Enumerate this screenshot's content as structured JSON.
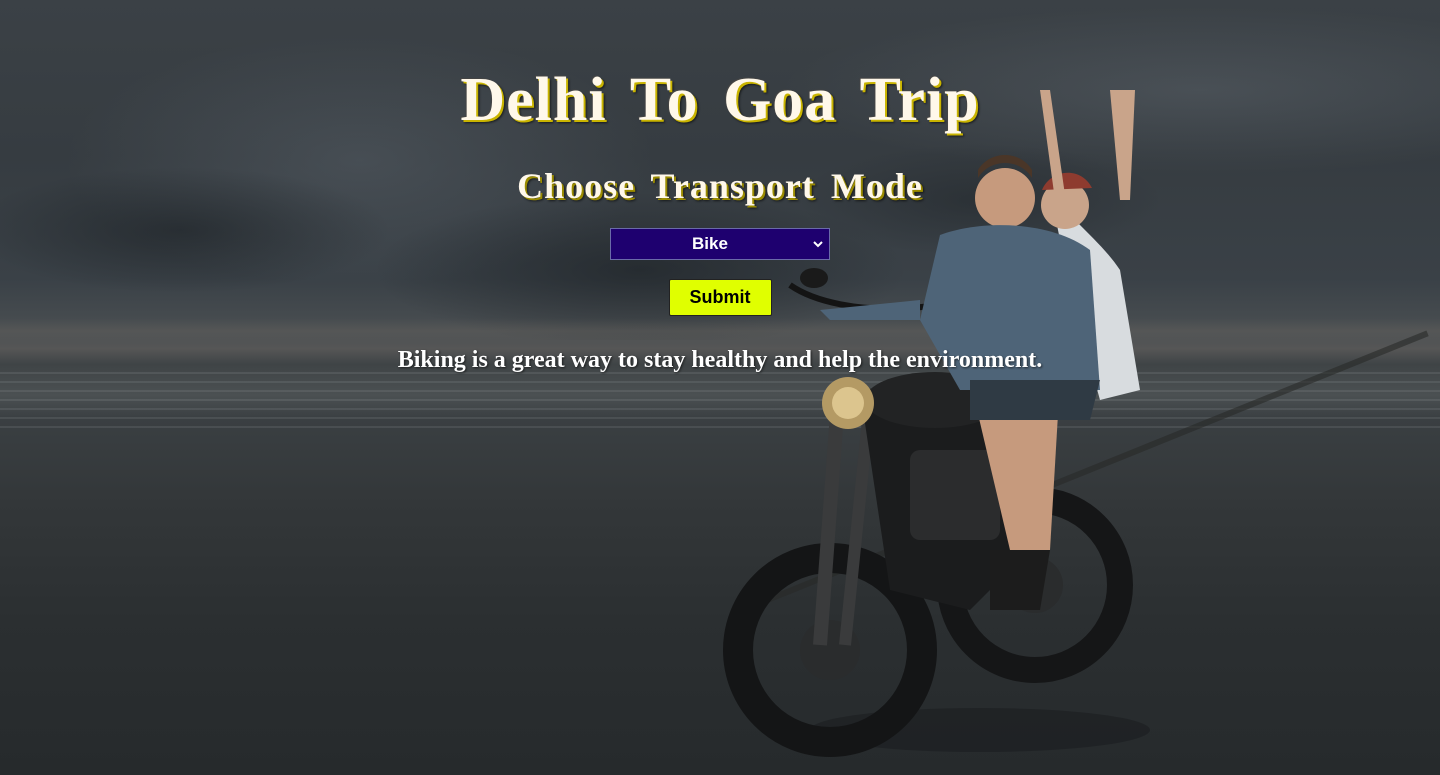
{
  "page": {
    "title": "Delhi To Goa Trip",
    "subtitle": "Choose Transport Mode"
  },
  "transport_select": {
    "selected": "Bike",
    "background_color": "#1e006f"
  },
  "submit": {
    "label": "Submit",
    "background_color": "#e0ff00"
  },
  "result": {
    "message": "Biking is a great way to stay healthy and help the environment."
  },
  "background": {
    "scene": "couple-riding-motorcycle-on-beach-photo"
  }
}
